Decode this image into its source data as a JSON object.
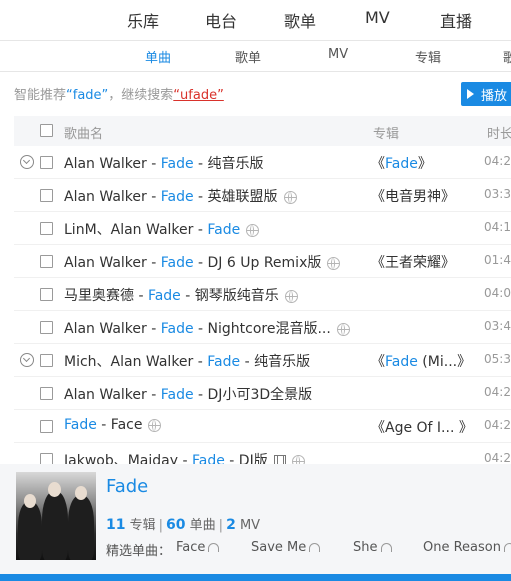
{
  "nav": [
    "乐库",
    "电台",
    "歌单",
    "MV",
    "直播"
  ],
  "tabs": [
    "单曲",
    "歌单",
    "MV",
    "专辑",
    "歌"
  ],
  "suggestion": {
    "prefix": "智能推荐",
    "keyword": "“fade”",
    "middle": "，继续搜索",
    "alt": "“ufade”"
  },
  "play_all": "播放",
  "columns": {
    "song": "歌曲名",
    "album": "专辑",
    "duration": "时长"
  },
  "songs": [
    {
      "artist": "Alan Walker",
      "sep": " - ",
      "hl": "Fade",
      "rest": " - 纯音乐版",
      "mark": "",
      "album_pre": "《",
      "album_hl": "Fade",
      "album_post": "》",
      "dur": "04:2",
      "expand": true
    },
    {
      "artist": "Alan Walker",
      "sep": " - ",
      "hl": "Fade",
      "rest": " - 英雄联盟版",
      "mark": "globe",
      "album_pre": "《电音男神》",
      "album_hl": "",
      "album_post": "",
      "dur": "03:3",
      "expand": false
    },
    {
      "artist": "LinM、Alan Walker",
      "sep": " - ",
      "hl": "Fade",
      "rest": "",
      "mark": "globe",
      "album_pre": "",
      "album_hl": "",
      "album_post": "",
      "dur": "04:1",
      "expand": false
    },
    {
      "artist": "Alan Walker",
      "sep": " - ",
      "hl": "Fade",
      "rest": " - DJ 6 Up Remix版",
      "mark": "globe",
      "album_pre": "《王者荣耀》",
      "album_hl": "",
      "album_post": "",
      "dur": "01:4",
      "expand": false
    },
    {
      "artist": "马里奥赛德",
      "sep": " - ",
      "hl": "Fade",
      "rest": " - 钢琴版纯音乐",
      "mark": "globe",
      "album_pre": "",
      "album_hl": "",
      "album_post": "",
      "dur": "04:0",
      "expand": false
    },
    {
      "artist": "Alan Walker",
      "sep": " - ",
      "hl": "Fade",
      "rest": " - Nightcore混音版...",
      "mark": "globe",
      "album_pre": "",
      "album_hl": "",
      "album_post": "",
      "dur": "03:4",
      "expand": false
    },
    {
      "artist": "Mich、Alan Walker",
      "sep": " - ",
      "hl": "Fade",
      "rest": " - 纯音乐版",
      "mark": "",
      "album_pre": "《",
      "album_hl": "Fade",
      "album_post": " (Mi...》",
      "dur": "05:3",
      "expand": true
    },
    {
      "artist": "Alan Walker",
      "sep": " - ",
      "hl": "Fade",
      "rest": " - DJ小可3D全景版",
      "mark": "",
      "album_pre": "",
      "album_hl": "",
      "album_post": "",
      "dur": "04:2",
      "expand": false
    },
    {
      "artist": "",
      "sep": "",
      "hl": "Fade",
      "rest": " - Face",
      "mark": "globe",
      "album_pre": "《Age Of I... 》",
      "album_hl": "",
      "album_post": "",
      "dur": "04:2",
      "expand": false
    },
    {
      "artist": "Jakwob、Maiday",
      "sep": " - ",
      "hl": "Fade",
      "rest": " - DJ版",
      "mark": "mv-globe",
      "album_pre": "",
      "album_hl": "",
      "album_post": "",
      "dur": "04:2",
      "expand": false
    }
  ],
  "artist": {
    "name": "Fade",
    "albums_count": "11",
    "albums_label": "专辑",
    "singles_count": "60",
    "singles_label": "单曲",
    "mv_count": "2",
    "mv_label": "MV",
    "picks_label": "精选单曲：",
    "picks": [
      "Face",
      "Save Me",
      "She",
      "One Reason"
    ]
  },
  "colors": {
    "accent": "#1a8ae3",
    "alt_keyword": "#d9322b"
  }
}
